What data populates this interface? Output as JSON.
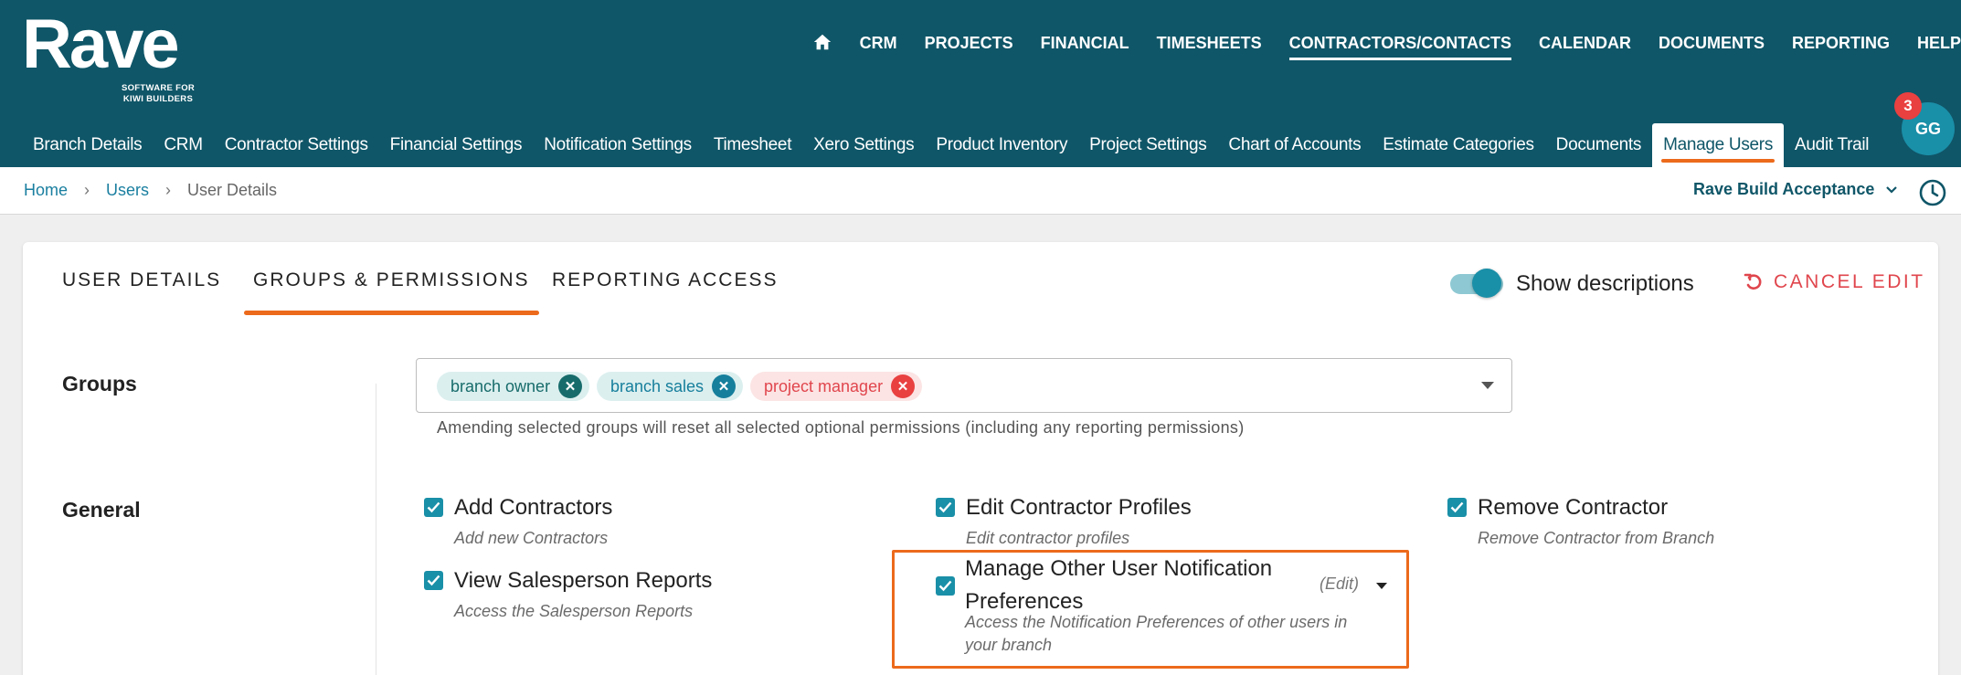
{
  "brand": {
    "name": "Rave",
    "tagline_line1": "SOFTWARE FOR",
    "tagline_line2": "KIWI BUILDERS"
  },
  "topnav": {
    "items": [
      "CRM",
      "PROJECTS",
      "FINANCIAL",
      "TIMESHEETS",
      "CONTRACTORS/CONTACTS",
      "CALENDAR",
      "DOCUMENTS",
      "REPORTING",
      "HELP"
    ],
    "active": "CONTRACTORS/CONTACTS"
  },
  "subnav": {
    "items": [
      "Branch Details",
      "CRM",
      "Contractor Settings",
      "Financial Settings",
      "Notification Settings",
      "Timesheet",
      "Xero Settings",
      "Product Inventory",
      "Project Settings",
      "Chart of Accounts",
      "Estimate Categories",
      "Documents",
      "Manage Users",
      "Audit Trail"
    ],
    "active": "Manage Users"
  },
  "user": {
    "initials": "GG",
    "notification_count": "3"
  },
  "breadcrumb": {
    "home": "Home",
    "users": "Users",
    "current": "User Details"
  },
  "branch_selector": {
    "value": "Rave Build Acceptance"
  },
  "tabs": {
    "user_details": "USER DETAILS",
    "groups_permissions": "GROUPS & PERMISSIONS",
    "reporting_access": "REPORTING ACCESS"
  },
  "options": {
    "show_descriptions_label": "Show descriptions",
    "show_descriptions": true,
    "cancel_edit_label": "CANCEL EDIT"
  },
  "groups": {
    "label": "Groups",
    "selected": [
      "branch owner",
      "branch sales",
      "project manager"
    ],
    "hint": "Amending selected groups will reset all selected optional permissions (including any reporting permissions)"
  },
  "general": {
    "label": "General",
    "permissions": [
      {
        "title": "Add Contractors",
        "desc": "Add new Contractors",
        "checked": true
      },
      {
        "title": "Edit Contractor Profiles",
        "desc": "Edit contractor profiles",
        "checked": true
      },
      {
        "title": "Remove Contractor",
        "desc": "Remove Contractor from Branch",
        "checked": true
      },
      {
        "title": "View Salesperson Reports",
        "desc": "Access the Salesperson Reports",
        "checked": true
      },
      {
        "title": "Manage Other User Notification Preferences",
        "desc": "Access the Notification Preferences of other users in your branch",
        "checked": true,
        "edit_label": "(Edit)"
      }
    ]
  },
  "colors": {
    "header": "#0f5668",
    "accent": "#1a8fa8",
    "highlight": "#ec6a1b",
    "danger": "#e0464d"
  }
}
